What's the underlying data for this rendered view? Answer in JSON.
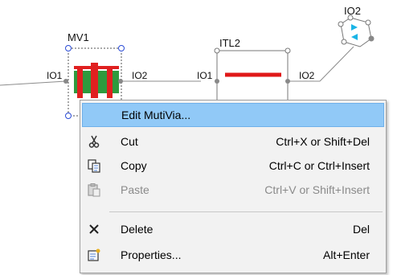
{
  "diagram": {
    "node_mv1": {
      "label": "MV1",
      "left_port": "IO1",
      "right_port": "IO2"
    },
    "node_itl2": {
      "label": "ITL2",
      "left_port": "IO1",
      "right_port": "IO2"
    },
    "node_io2": {
      "label": "IO2"
    },
    "colors": {
      "line": "#8c8c8c",
      "mv_body": "#2e9a3e",
      "mv_bar": "#e02020",
      "itl_line": "#e01818",
      "io_arrow": "#19b4e6",
      "handle": "#2a4bd6"
    }
  },
  "context_menu": {
    "items": [
      {
        "label": "Edit MutiVia...",
        "shortcut": "",
        "icon": "none",
        "state": "highlighted"
      },
      {
        "label": "Cut",
        "shortcut": "Ctrl+X or Shift+Del",
        "icon": "scissors-icon",
        "state": "enabled"
      },
      {
        "label": "Copy",
        "shortcut": "Ctrl+C or Ctrl+Insert",
        "icon": "copy-icon",
        "state": "enabled"
      },
      {
        "label": "Paste",
        "shortcut": "Ctrl+V or Shift+Insert",
        "icon": "paste-icon",
        "state": "disabled"
      },
      {
        "label": "Delete",
        "shortcut": "Del",
        "icon": "delete-x-icon",
        "state": "enabled"
      },
      {
        "label": "Properties...",
        "shortcut": "Alt+Enter",
        "icon": "properties-icon",
        "state": "enabled"
      }
    ]
  }
}
